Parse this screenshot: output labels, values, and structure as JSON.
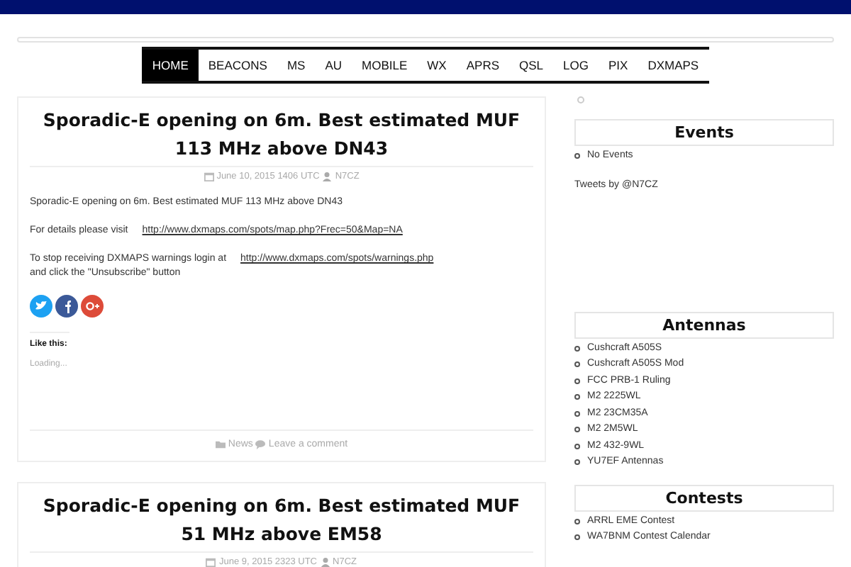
{
  "nav": [
    {
      "label": "HOME",
      "selected": true
    },
    {
      "label": "BEACONS",
      "selected": false
    },
    {
      "label": "MS",
      "selected": false
    },
    {
      "label": "AU",
      "selected": false
    },
    {
      "label": "MOBILE",
      "selected": false
    },
    {
      "label": "WX",
      "selected": false
    },
    {
      "label": "APRS",
      "selected": false
    },
    {
      "label": "QSL",
      "selected": false
    },
    {
      "label": "LOG",
      "selected": false
    },
    {
      "label": "PIX",
      "selected": false
    },
    {
      "label": "DXMAPS",
      "selected": false
    }
  ],
  "posts": [
    {
      "title": "Sporadic-E opening on 6m. Best estimated MUF 113 MHz above DN43",
      "date": "June 10, 2015 1406 UTC",
      "author": "N7CZ",
      "paragraphs": [
        {
          "text": "Sporadic-E opening on 6m. Best estimated MUF 113 MHz above DN43"
        },
        {
          "text": "For details please visit",
          "link": "http://www.dxmaps.com/spots/map.php?Frec=50&Map=NA"
        },
        {
          "text": "To stop receiving DXMAPS warnings login at",
          "link": "http://www.dxmaps.com/spots/warnings.php",
          "after": "and click the \"Unsubscribe\" button"
        }
      ],
      "like_label": "Like this:",
      "loading": "Loading...",
      "category": "News",
      "comment_link": "Leave a comment"
    },
    {
      "title": "Sporadic-E opening on 6m. Best estimated MUF 51 MHz above EM58",
      "date": "June 9, 2015 2323 UTC",
      "author": "N7CZ"
    }
  ],
  "sidebar": {
    "widgets": [
      {
        "title": "Events",
        "items": [
          "No Events"
        ],
        "note": "Tweets by @N7CZ"
      },
      {
        "title": "Antennas",
        "items": [
          "Cushcraft A505S",
          "Cushcraft A505S Mod",
          "FCC PRB-1 Ruling",
          "M2 2225WL",
          "M2 23CM35A",
          "M2 2M5WL",
          "M2 432-9WL",
          "YU7EF Antennas"
        ]
      },
      {
        "title": "Contests",
        "items": [
          "ARRL EME Contest",
          "WA7BNM Contest Calendar"
        ]
      }
    ]
  }
}
